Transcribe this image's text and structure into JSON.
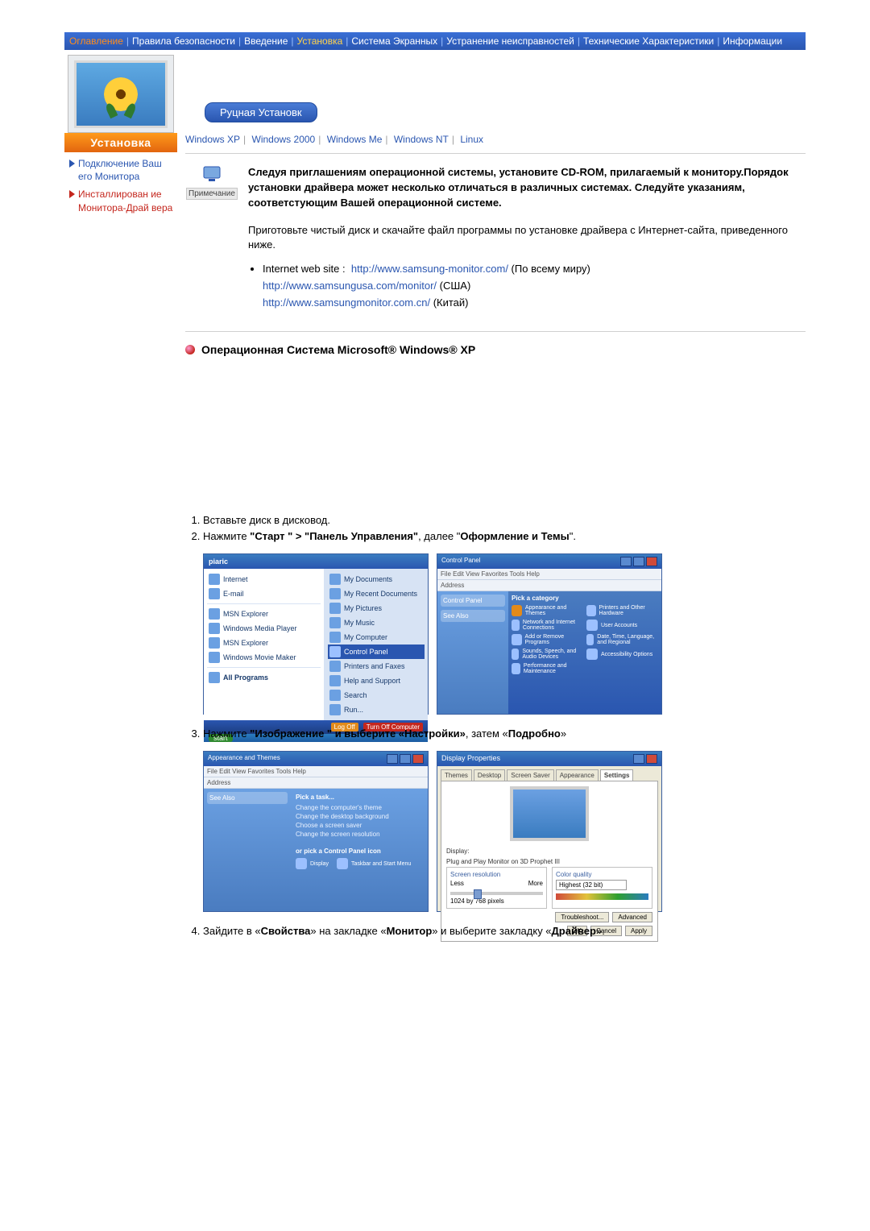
{
  "topbar": {
    "items": [
      {
        "label": "Оглавление",
        "cls": "oran"
      },
      {
        "label": "Правила безопасности",
        "cls": ""
      },
      {
        "label": "Введение",
        "cls": ""
      },
      {
        "label": "Установка",
        "cls": "hl"
      },
      {
        "label": "Система Экранных ",
        "cls": ""
      },
      {
        "label": "Устранение неисправностей",
        "cls": ""
      },
      {
        "label": "Технические Характеристики",
        "cls": ""
      },
      {
        "label": "Информации",
        "cls": ""
      }
    ]
  },
  "sidebar": {
    "install_label": "Установка",
    "links": [
      {
        "label": "Подключение Ваш его Монитора",
        "cls": "blue"
      },
      {
        "label": "Инсталлирован ие Монитора-Драй вера",
        "cls": "red"
      }
    ]
  },
  "tab": {
    "label": "Руцная Установк"
  },
  "os_links": [
    "Windows XP",
    "Windows 2000",
    "Windows Me",
    "Windows NT",
    "Linux"
  ],
  "note_label": "Примечание",
  "note_bold": "Следуя приглашениям операционной системы, установите CD-ROM, прилагаемый к монитору.Порядок установки драйвера может несколько отличаться в различных системах. Следуйте указаниям, соответстующим Вашей операционной системе.",
  "note_plain": "Приготовьте чистый диск и скачайте файл программы по установке драйвера с Интернет-сайта, приведенного ниже.",
  "web_label": "Internet web site :",
  "sites": [
    {
      "url": "http://www.samsung-monitor.com/",
      "suffix": " (По всему миру)"
    },
    {
      "url": "http://www.samsungusa.com/monitor/",
      "suffix": " (США)"
    },
    {
      "url": "http://www.samsungmonitor.com.cn/",
      "suffix": " (Китай)"
    }
  ],
  "os_heading": "Операционная Система Microsoft® Windows® XP",
  "steps": {
    "s1": "Вставьте диск в дисковод.",
    "s2_a": "Нажмите ",
    "s2_b": "\"Старт \" > \"Панель Управления\"",
    "s2_c": ", далее \"",
    "s2_d": "Оформление и Темы",
    "s2_e": "\".",
    "s3_a": "Нажмите ",
    "s3_b": "\"Изображение \" и выберите «Настройки»",
    "s3_c": ", затем «",
    "s3_d": "Подробно",
    "s3_e": "»",
    "s4_a": "Зайдите в «",
    "s4_b": "Свойства",
    "s4_c": "» на закладке «",
    "s4_d": "Монитор",
    "s4_e": "» и выберите закладку «",
    "s4_f": "Драйвер",
    "s4_g": "»."
  },
  "start_menu": {
    "user": "piaric",
    "left": [
      "Internet",
      "E-mail",
      "MSN Explorer",
      "Windows Media Player",
      "MSN Explorer",
      "Windows Movie Maker",
      "All Programs"
    ],
    "right": [
      "My Documents",
      "My Recent Documents",
      "My Pictures",
      "My Music",
      "My Computer",
      "Control Panel",
      "Printers and Faxes",
      "Help and Support",
      "Search",
      "Run..."
    ],
    "highlight_index": 5,
    "logoff": "Log Off",
    "shutdown": "Turn Off Computer",
    "start": "start"
  },
  "cpanel": {
    "title": "Control Panel",
    "menu": "File  Edit  View  Favorites  Tools  Help",
    "addr": "Address",
    "left_boxes": [
      "Control Panel",
      "See Also"
    ],
    "cat_label": "Pick a category",
    "cats": [
      "Appearance and Themes",
      "Printers and Other Hardware",
      "Network and Internet Connections",
      "User Accounts",
      "Add or Remove Programs",
      "Date, Time, Language, and Regional",
      "Sounds, Speech, and Audio Devices",
      "Accessibility Options",
      "Performance and Maintenance",
      ""
    ]
  },
  "appear": {
    "title": "Appearance and Themes",
    "menu": "File  Edit  View  Favorites  Tools  Help",
    "left_h": "See Also",
    "pick_task": "Pick a task...",
    "tasks": [
      "Change the computer's theme",
      "Change the desktop background",
      "Choose a screen saver",
      "Change the screen resolution"
    ],
    "or_pick": "or pick a Control Panel icon",
    "icons": [
      "Display",
      "Taskbar and Start Menu"
    ]
  },
  "display": {
    "title": "Display Properties",
    "tabs": [
      "Themes",
      "Desktop",
      "Screen Saver",
      "Appearance",
      "Settings"
    ],
    "active_tab": 4,
    "disp_lbl": "Display:",
    "disp_val": "Plug and Play Monitor on 3D Prophet III",
    "res_title": "Screen resolution",
    "res_less": "Less",
    "res_more": "More",
    "res_val": "1024 by 768 pixels",
    "col_title": "Color quality",
    "col_val": "Highest (32 bit)",
    "btn_trouble": "Troubleshoot...",
    "btn_adv": "Advanced",
    "btn_ok": "OK",
    "btn_cancel": "Cancel",
    "btn_apply": "Apply"
  }
}
